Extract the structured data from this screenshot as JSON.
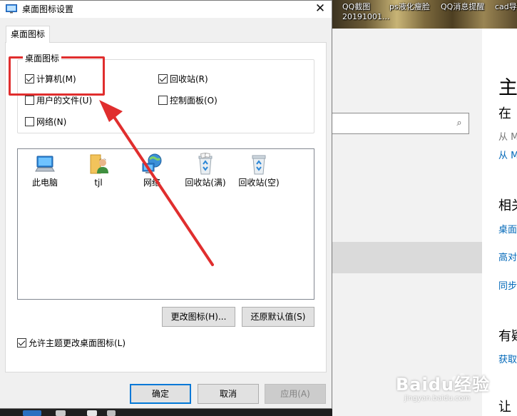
{
  "dialog": {
    "title": "桌面图标设置",
    "close_glyph": "✕",
    "tab_label": "桌面图标",
    "group_label": "桌面图标",
    "checkboxes": [
      {
        "label": "计算机(M)",
        "checked": true
      },
      {
        "label": "回收站(R)",
        "checked": true
      },
      {
        "label": "用户的文件(U)",
        "checked": false
      },
      {
        "label": "控制面板(O)",
        "checked": false
      },
      {
        "label": "网络(N)",
        "checked": false
      }
    ],
    "icons": [
      {
        "label": "此电脑",
        "icon": "computer-icon"
      },
      {
        "label": "tjl",
        "icon": "user-folder-icon"
      },
      {
        "label": "网络",
        "icon": "network-icon"
      },
      {
        "label": "回收站(满)",
        "icon": "recycle-bin-full-icon"
      },
      {
        "label": "回收站(空)",
        "icon": "recycle-bin-empty-icon"
      }
    ],
    "change_icon_button": "更改图标(H)...",
    "restore_default_button": "还原默认值(S)",
    "allow_theme_checkbox": {
      "label": "允许主题更改桌面图标(L)",
      "checked": true
    },
    "ok_button": "确定",
    "cancel_button": "取消",
    "apply_button": "应用(A)"
  },
  "desktop": {
    "items": [
      "QQ截图\n20191001...",
      "ps液化瘦脸",
      "QQ消息提醒",
      "cad导"
    ]
  },
  "settings": {
    "title": "主",
    "subtitle": "在",
    "gray_text": "从 M",
    "link1": "从 M",
    "section1": "相关",
    "links": [
      "桌面",
      "高对",
      "同步"
    ],
    "section2": "有疑",
    "link_help": "获取",
    "section3": "让"
  },
  "watermark": {
    "text": "Baidu经验",
    "url": "jingyan.baidu.com"
  },
  "colors": {
    "annotation_red": "#e02e2e",
    "accent": "#0078d7",
    "link": "#0067b8"
  }
}
